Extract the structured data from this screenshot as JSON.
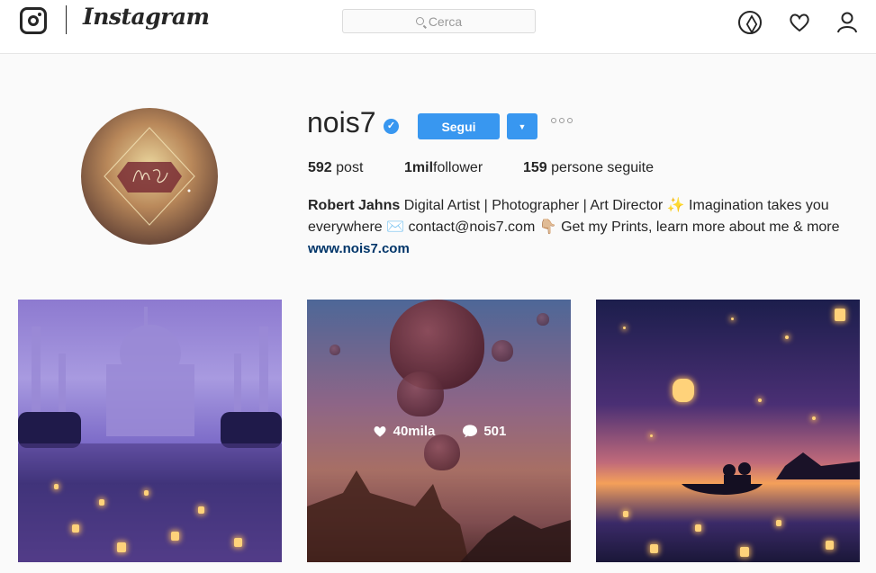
{
  "nav": {
    "brand": "Instagram",
    "search_placeholder": "Cerca",
    "icons": [
      "explore-icon",
      "heart-icon",
      "profile-icon"
    ]
  },
  "profile": {
    "username": "nois7",
    "follow_label": "Segui",
    "dropdown_glyph": "▼",
    "stats": {
      "posts_count": "592",
      "posts_label": "post",
      "followers_count": "1mil",
      "followers_label": "follower",
      "following_count": "159",
      "following_label": "persone seguite"
    },
    "bio": {
      "name": "Robert Jahns",
      "text_1": "Digital Artist | Photographer | Art Director ✨ Imagination takes you everywhere ✉️ contact@nois7.com 👇🏼 Get my Prints, learn more about me & more",
      "link": "www.nois7.com"
    }
  },
  "grid": {
    "posts": [
      {
        "name": "taj-mahal-lanterns-post"
      },
      {
        "name": "hot-air-balloons-post",
        "likes": "40mila",
        "comments": "501"
      },
      {
        "name": "lanterns-boat-post"
      }
    ]
  },
  "colors": {
    "accent": "#3897f0",
    "link": "#003569",
    "background": "#fafafa"
  }
}
